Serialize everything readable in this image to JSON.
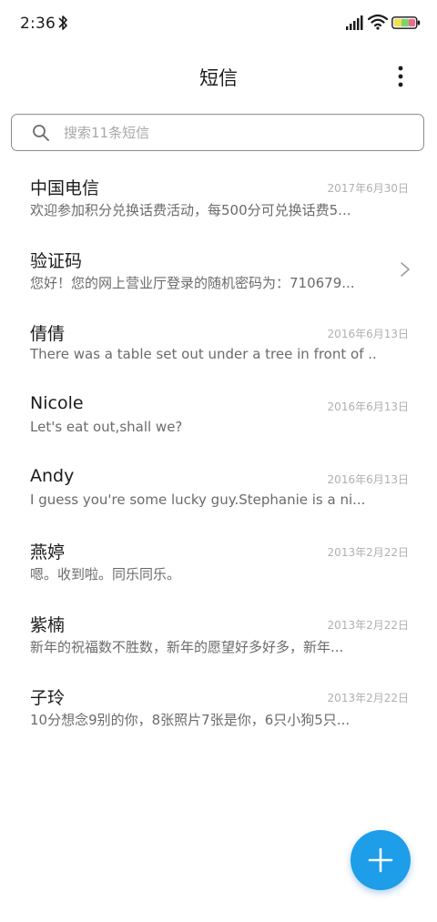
{
  "status_bar": {
    "time": "2:36",
    "icons": [
      "bluetooth-icon",
      "signal-icon",
      "wifi-icon",
      "battery-icon"
    ]
  },
  "app_bar": {
    "title": "短信",
    "more_icon": "more-vertical-icon"
  },
  "search": {
    "placeholder": "搜索11条短信",
    "value": ""
  },
  "conversations": [
    {
      "name": "中国电信",
      "date": "2017年6月30日",
      "snippet": "欢迎参加积分兑换话费活动，每500分可兑换话费5..."
    },
    {
      "name": "验证码",
      "date": "",
      "snippet": "您好！您的网上营业厅登录的随机密码为：710679...",
      "has_chevron": true
    },
    {
      "name": "倩倩",
      "date": "2016年6月13日",
      "snippet": "There was a table set out under a tree in front of ..."
    },
    {
      "name": "Nicole",
      "date": "2016年6月13日",
      "snippet": "Let's eat out,shall we?"
    },
    {
      "name": "Andy",
      "date": "2016年6月13日",
      "snippet": "I guess you're some lucky guy.Stephanie is a ni..."
    },
    {
      "name": "燕婷",
      "date": "2013年2月22日",
      "snippet": "嗯。收到啦。同乐同乐。"
    },
    {
      "name": "紫楠",
      "date": "2013年2月22日",
      "snippet": "新年的祝福数不胜数，新年的愿望好多好多，新年..."
    },
    {
      "name": "子玲",
      "date": "2013年2月22日",
      "snippet": "10分想念9别的你，8张照片7张是你，6只小狗5只..."
    }
  ],
  "fab": {
    "icon": "plus-icon"
  },
  "colors": {
    "accent": "#1e9de8",
    "title_text": "#1b1b1b",
    "snippet_text": "#6b6b6b",
    "date_text": "#b0b0b0",
    "placeholder_text": "#a8a8a8"
  }
}
